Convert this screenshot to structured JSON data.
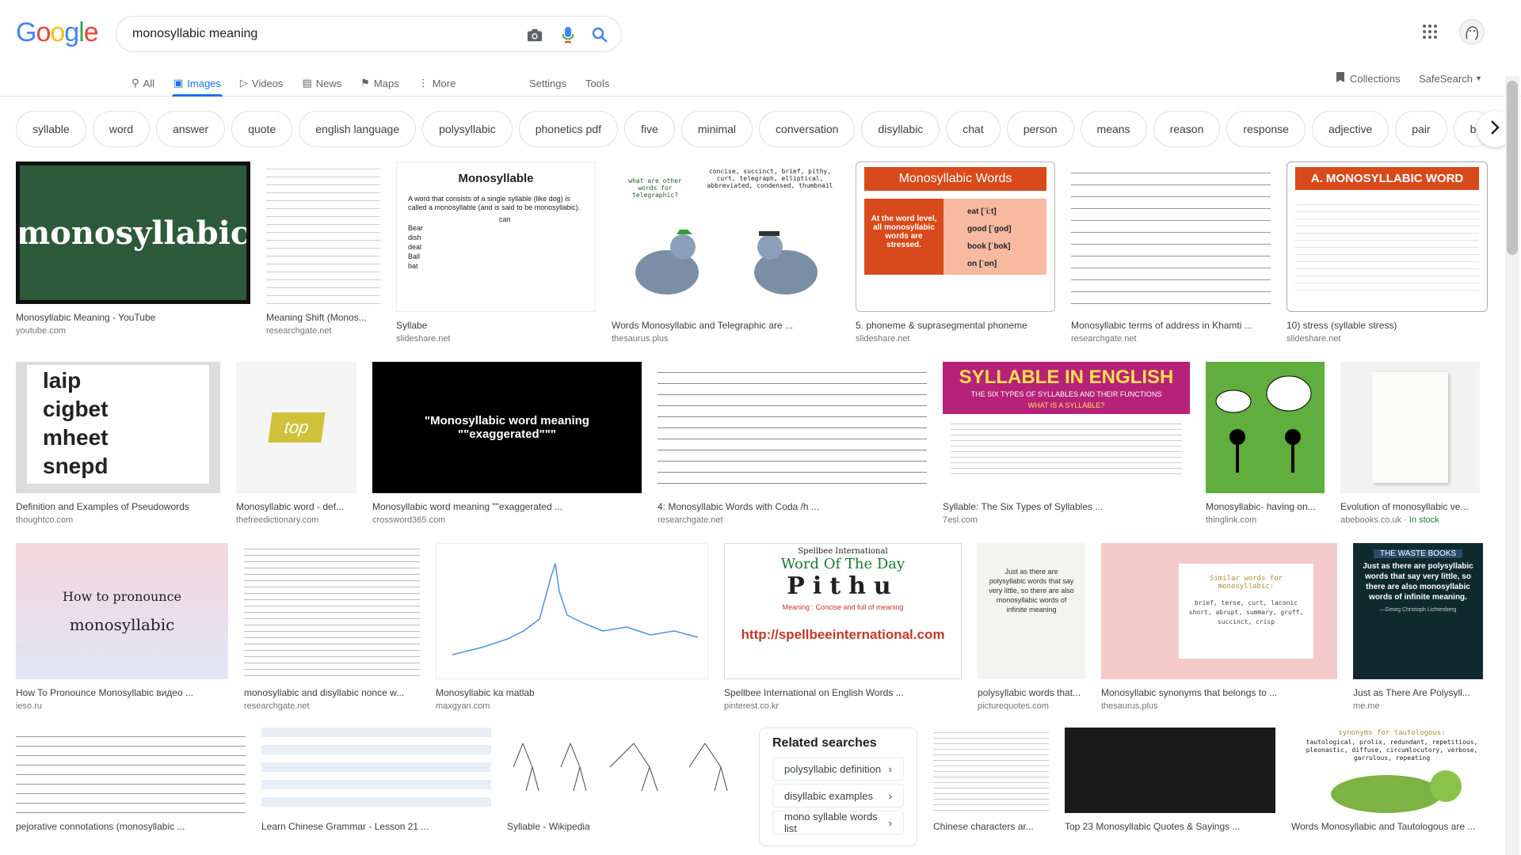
{
  "logo": [
    "G",
    "o",
    "o",
    "g",
    "l",
    "e"
  ],
  "logo_colors": [
    "#4285f4",
    "#ea4335",
    "#fbbc05",
    "#4285f4",
    "#34a853",
    "#ea4335"
  ],
  "search": {
    "value": "monosyllabic meaning"
  },
  "tabs": [
    {
      "label": "All",
      "icon": "search-icon"
    },
    {
      "label": "Images",
      "icon": "image-icon"
    },
    {
      "label": "Videos",
      "icon": "video-icon"
    },
    {
      "label": "News",
      "icon": "news-icon"
    },
    {
      "label": "Maps",
      "icon": "map-icon"
    },
    {
      "label": "More",
      "icon": "more-icon"
    }
  ],
  "tools": {
    "settings": "Settings",
    "tools": "Tools"
  },
  "right_links": {
    "collections": "Collections",
    "safesearch": "SafeSearch"
  },
  "chips": [
    "syllable",
    "word",
    "answer",
    "quote",
    "english language",
    "polysyllabic",
    "phonetics pdf",
    "five",
    "minimal",
    "conversation",
    "disyllabic",
    "chat",
    "person",
    "means",
    "reason",
    "response",
    "adjective",
    "pair",
    "b"
  ],
  "results": [
    [
      {
        "title": "Monosyllabic Meaning - YouTube",
        "source": "youtube.com"
      },
      {
        "title": "Meaning Shift (Monos...",
        "source": "researchgate.net"
      },
      {
        "title": "Syllabe",
        "source": "slideshare.net"
      },
      {
        "title": "Words Monosyllabic and Telegraphic are ...",
        "source": "thesaurus.plus"
      },
      {
        "title": "5. phoneme & suprasegmental phoneme",
        "source": "slideshare.net"
      },
      {
        "title": "Monosyllabic terms of address in Khamti ...",
        "source": "researchgate.net"
      },
      {
        "title": "10) stress (syllable stress)",
        "source": "slideshare.net"
      }
    ],
    [
      {
        "title": "Definition and Examples of Pseudowords",
        "source": "thoughtco.com"
      },
      {
        "title": "Monosyllabic word - def...",
        "source": "thefreedictionary.com"
      },
      {
        "title": "Monosyllabic word meaning \"\"exaggerated ...",
        "source": "crossword365.com"
      },
      {
        "title": "4: Monosyllabic Words with Coda /h ...",
        "source": "researchgate.net"
      },
      {
        "title": "Syllable: The Six Types of Syllables ...",
        "source": "7esl.com"
      },
      {
        "title": "Monosyllabic- having on...",
        "source": "thinglink.com"
      },
      {
        "title": "Evolution of monosyllabic ve...",
        "source": "abebooks.co.uk",
        "badge": "In stock"
      }
    ],
    [
      {
        "title": "How To Pronounce Monosyllabic видео ...",
        "source": "ieso.ru"
      },
      {
        "title": "monosyllabic and disyllabic nonce w...",
        "source": "researchgate.net"
      },
      {
        "title": "Monosyllabic ka matlab",
        "source": "maxgyan.com"
      },
      {
        "title": "Spellbee International on English Words ...",
        "source": "pinterest.co.kr"
      },
      {
        "title": "polysyllabic words that...",
        "source": "picturequotes.com"
      },
      {
        "title": "Monosyllabic synonyms that belongs to ...",
        "source": "thesaurus.plus"
      },
      {
        "title": "Just as There Are Polysyll...",
        "source": "me.me"
      }
    ],
    [
      {
        "title": "pejorative connotations (monosyllabic ...",
        "source": ""
      },
      {
        "title": "Learn Chinese Grammar - Lesson 21 ...",
        "source": ""
      },
      {
        "title": "Syllable - Wikipedia",
        "source": ""
      },
      {
        "title": "Chinese characters ar...",
        "source": ""
      },
      {
        "title": "Top 23 Monosyllabic Quotes & Sayings ...",
        "source": ""
      },
      {
        "title": "Words Monosyllabic and Tautologous are ...",
        "source": ""
      }
    ]
  ],
  "related": {
    "heading": "Related searches",
    "items": [
      "polysyllabic definition",
      "disyllabic examples",
      "mono syllable words list"
    ]
  },
  "thumb_text": {
    "monosyllabic": "monosyllabic",
    "syllabe_title": "Monosyllable",
    "syllabe_body": "A word that consists of a single syllable (like dog) is called a monosyllable (and is said to be monosyllabic).",
    "syllabe_list": [
      "Bear",
      "dish",
      "deal",
      "Ball",
      "bat"
    ],
    "syllabe_can": "can",
    "telegraphic_q": "what are other words for telegraphic?",
    "telegraphic_a": "concise, succinct, brief, pithy, curt, telegraph, elliptical, abbreviated, condensed, thumbnail",
    "mono_words_title": "Monosyllabic Words",
    "mono_words_left": "At the word level, all monosyllabic words are stressed.",
    "mono_words_right": [
      "eat [ˈiːt]",
      "good [ˈgod]",
      "book [ˈbok]",
      "on [ˈɒn]"
    ],
    "a_mono_title": "A. MONOSYLLABIC WORD",
    "pseudo": [
      "laip",
      "cigbet",
      "mheet",
      "snepd"
    ],
    "top": "top",
    "crossword": "\"Monosyllabic word meaning \"\"exaggerated\"\"\"",
    "syl_eng_title": "SYLLABLE IN ENGLISH",
    "syl_eng_sub": "THE SIX TYPES OF SYLLABLES AND THEIR FUNCTIONS",
    "syl_eng_q": "WHAT IS A SYLLABLE?",
    "pron_1": "How to pronounce",
    "pron_2": "monosyllabic",
    "spellbee_head": "Spellbee International",
    "spellbee_wotd": "Word Of The Day",
    "spellbee_word": "Pithu",
    "spellbee_meaning": "Meaning : Concise and full of meaning",
    "spellbee_url": "http://spellbeeinternational.com",
    "poly_quote": "Just as there are polysyllabic words that say very little, so there are also monosyllabic words of infinite meaning",
    "similar_title": "Similar words for monosyllabic:",
    "similar_words": "brief, terse, curt, laconic short, abrupt, summary, gruff, succinct, crisp",
    "waste_title": "THE WASTE BOOKS",
    "waste_quote": "Just as there are polysyllabic words that say very little, so there are also monosyllabic words of infinite meaning.",
    "waste_author": "—Georg Christoph Lichtenberg",
    "taut_head": "synonyms for tautologous:",
    "taut_words": "tautological, prolix, redundant, repetitious, pleonastic, diffuse, circumlocutory, verbose, garrulous, repeating"
  },
  "colors": {
    "accent": "#1a73e8",
    "text": "#202124",
    "muted": "#70757a",
    "border": "#dfe1e5"
  }
}
